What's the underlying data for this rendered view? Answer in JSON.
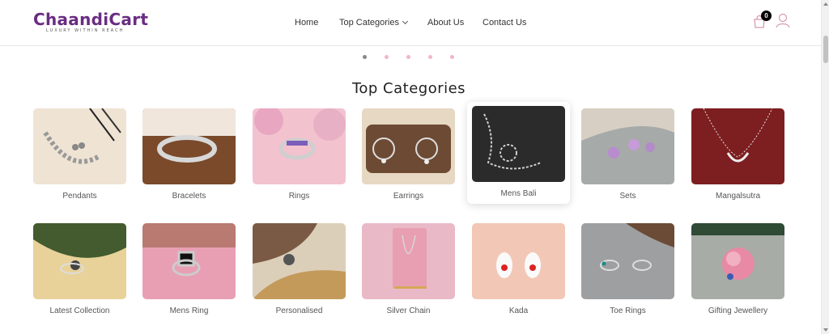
{
  "brand": {
    "name": "ChaandiCart",
    "tagline": "LUXURY WITHIN REACH",
    "accent": "#6a2c83"
  },
  "nav": {
    "items": [
      {
        "label": "Home",
        "has_dropdown": false
      },
      {
        "label": "Top Categories",
        "has_dropdown": true
      },
      {
        "label": "About Us",
        "has_dropdown": false
      },
      {
        "label": "Contact Us",
        "has_dropdown": false
      }
    ]
  },
  "header_icons": {
    "cart_icon": "shopping-bag-icon",
    "cart_count": "0",
    "user_icon": "user-icon"
  },
  "carousel": {
    "dot_count": 5,
    "active_index": 0
  },
  "section": {
    "title": "Top Categories"
  },
  "categories": [
    {
      "label": "Pendants",
      "bg": "#efe3d3",
      "featured": false
    },
    {
      "label": "Bracelets",
      "bg": "#7a4a2a",
      "featured": false
    },
    {
      "label": "Rings",
      "bg": "#f3c2cf",
      "featured": false
    },
    {
      "label": "Earrings",
      "bg": "#d8c9b4",
      "featured": false
    },
    {
      "label": "Mens Bali",
      "bg": "#2b2b2b",
      "featured": true
    },
    {
      "label": "Sets",
      "bg": "#a6aaa9",
      "featured": false
    },
    {
      "label": "Mangalsutra",
      "bg": "#7d1e20",
      "featured": false
    },
    {
      "label": "Latest Collection",
      "bg": "#e8d29a",
      "featured": false
    },
    {
      "label": "Mens Ring",
      "bg": "#e99fb3",
      "featured": false
    },
    {
      "label": "Personalised",
      "bg": "#c49a5a",
      "featured": false
    },
    {
      "label": "Silver Chain",
      "bg": "#eab9c8",
      "featured": false
    },
    {
      "label": "Kada",
      "bg": "#f3c7b6",
      "featured": false
    },
    {
      "label": "Toe Rings",
      "bg": "#9e9fa0",
      "featured": false
    },
    {
      "label": "Gifting Jewellery",
      "bg": "#a8aca6",
      "featured": false
    }
  ]
}
